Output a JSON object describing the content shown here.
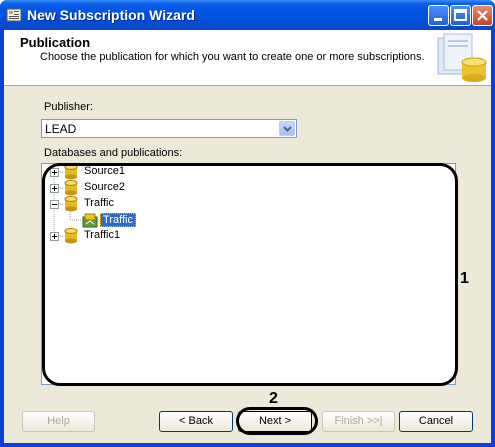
{
  "window": {
    "title": "New Subscription Wizard"
  },
  "header": {
    "title": "Publication",
    "subtitle": "Choose the publication for which you want to create one or more subscriptions."
  },
  "publisher": {
    "label": "Publisher:",
    "value": "LEAD"
  },
  "databases": {
    "label": "Databases and publications:",
    "items": [
      {
        "label": "Source1",
        "expanded": false
      },
      {
        "label": "Source2",
        "expanded": false
      },
      {
        "label": "Traffic",
        "expanded": true,
        "children": [
          {
            "label": "Traffic",
            "selected": true
          }
        ]
      },
      {
        "label": "Traffic1",
        "expanded": false
      }
    ]
  },
  "callouts": [
    "1",
    "2"
  ],
  "buttons": {
    "help": "Help",
    "back": "< Back",
    "next": "Next >",
    "finish": "Finish >>|",
    "cancel": "Cancel"
  },
  "colors": {
    "titlebar": "#0054e3",
    "selection": "#316ac5",
    "dialog": "#ece9d8"
  }
}
